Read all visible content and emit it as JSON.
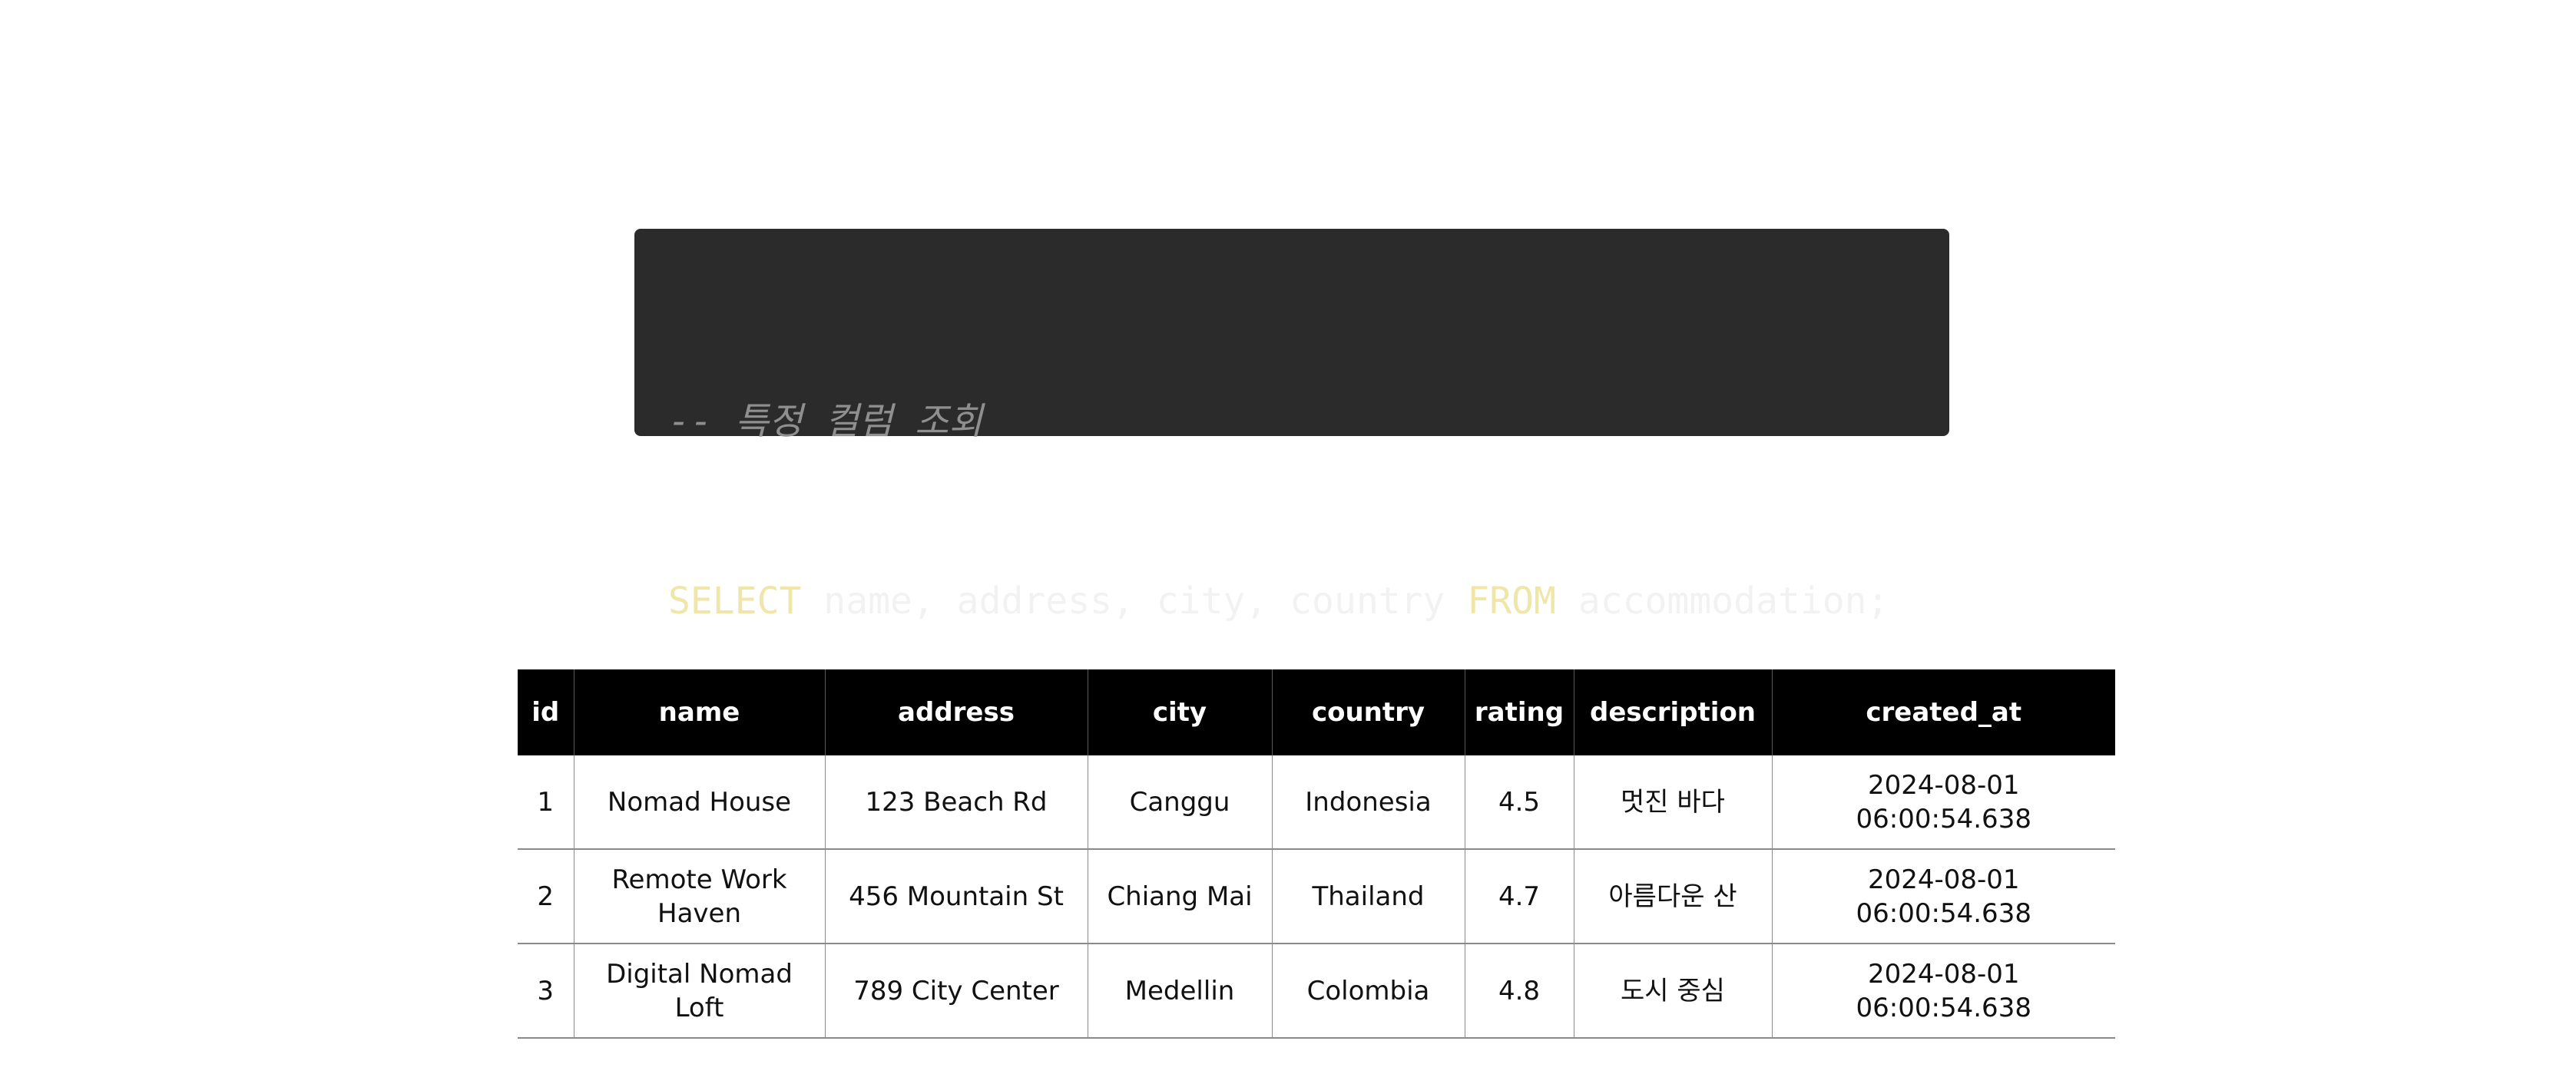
{
  "code": {
    "comment": "-- 특정 컬럼 조회",
    "tokens": [
      {
        "text": "SELECT",
        "type": "keyword"
      },
      {
        "text": " name, address, city, country ",
        "type": "plain"
      },
      {
        "text": "FROM",
        "type": "keyword"
      },
      {
        "text": " accommodation;",
        "type": "plain"
      }
    ],
    "colors": {
      "background": "#2b2b2b",
      "keyword": "#f0e6a8",
      "comment": "#8f8f8f",
      "text": "#f2f2f2"
    }
  },
  "table": {
    "headers": [
      "id",
      "name",
      "address",
      "city",
      "country",
      "rating",
      "description",
      "created_at"
    ],
    "rows": [
      [
        "1",
        "Nomad House",
        "123 Beach Rd",
        "Canggu",
        "Indonesia",
        "4.5",
        "멋진 바다",
        "2024-08-01 06:00:54.638"
      ],
      [
        "2",
        "Remote Work Haven",
        "456 Mountain St",
        "Chiang Mai",
        "Thailand",
        "4.7",
        "아름다운 산",
        "2024-08-01 06:00:54.638"
      ],
      [
        "3",
        "Digital Nomad Loft",
        "789 City Center",
        "Medellin",
        "Colombia",
        "4.8",
        "도시 중심",
        "2024-08-01 06:00:54.638"
      ]
    ]
  }
}
